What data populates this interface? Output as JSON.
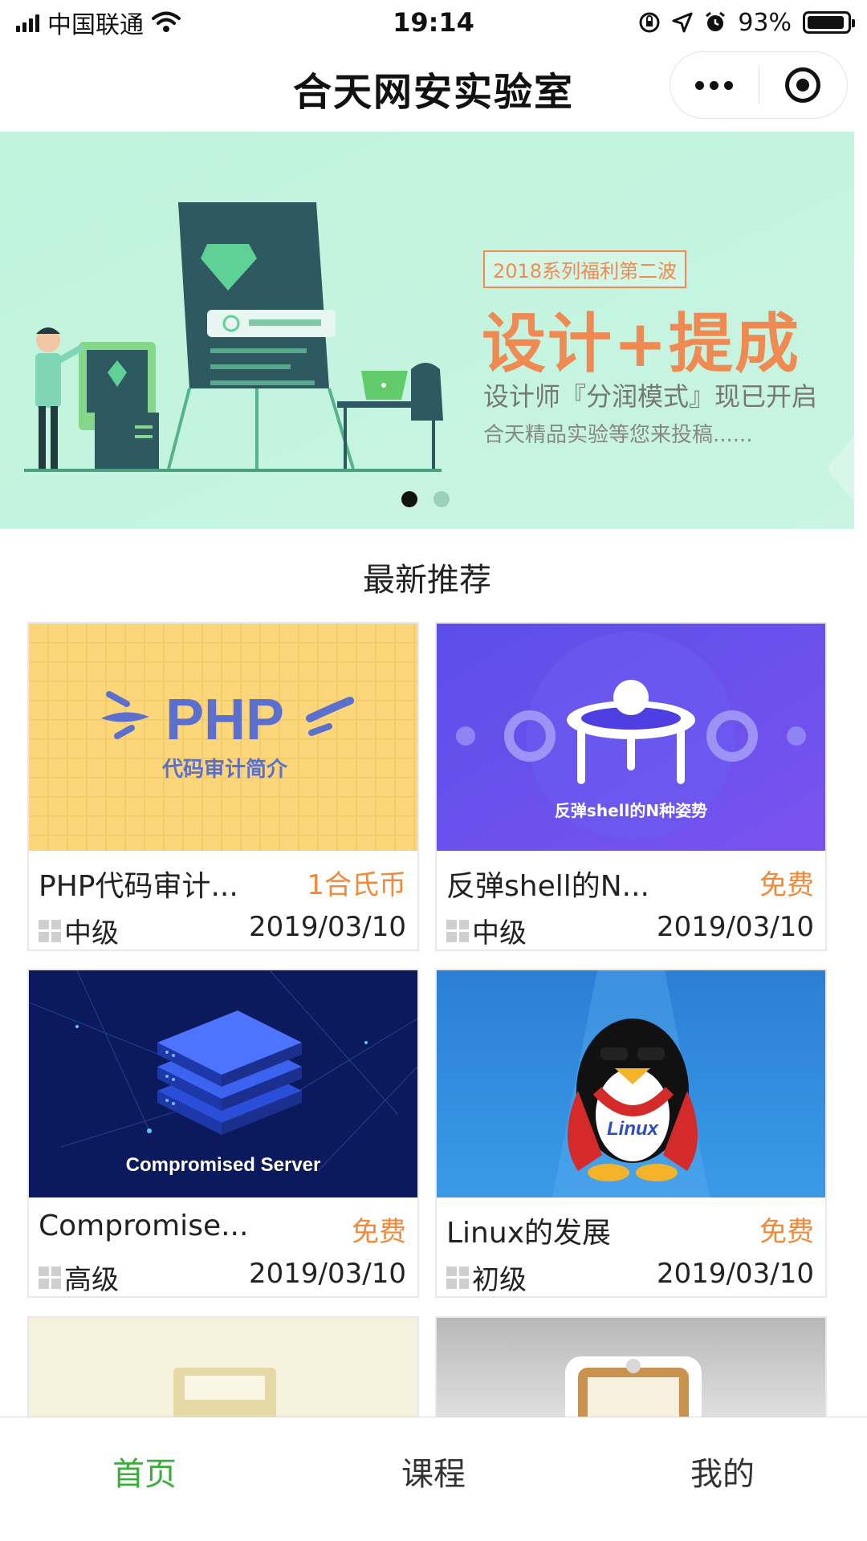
{
  "status_bar": {
    "carrier": "中国联通",
    "time": "19:14",
    "battery": "93%",
    "battery_level": 0.93,
    "icons": [
      "signal-icon",
      "wifi-icon",
      "rotation-lock-icon",
      "location-icon",
      "alarm-icon",
      "battery-icon"
    ]
  },
  "nav": {
    "title": "合天网安实验室",
    "more_icon": "more-dots-icon",
    "close_icon": "target-icon"
  },
  "banner": {
    "tag": "2018系列福利第二波",
    "headline": "设计+提成",
    "subtitle": "设计师『分润模式』现已开启",
    "subtitle2": "合天精品实验等您来投稿......",
    "page_count": 2,
    "active_page": 1
  },
  "section": {
    "title": "最新推荐"
  },
  "courses": [
    {
      "title": "PHP代码审计...",
      "price": "1合氏币",
      "level": "中级",
      "date": "2019/03/10",
      "thumb_text": "PHP",
      "thumb_sub": "代码审计简介"
    },
    {
      "title": "反弹shell的N...",
      "price": "免费",
      "level": "中级",
      "date": "2019/03/10",
      "thumb_text": "反弹shell的N种姿势"
    },
    {
      "title": "Compromise...",
      "price": "免费",
      "level": "高级",
      "date": "2019/03/10",
      "thumb_text": "Compromised Server"
    },
    {
      "title": "Linux的发展",
      "price": "免费",
      "level": "初级",
      "date": "2019/03/10",
      "thumb_text": "Linux"
    }
  ],
  "tabs": [
    {
      "label": "首页",
      "active": true
    },
    {
      "label": "课程",
      "active": false
    },
    {
      "label": "我的",
      "active": false
    }
  ],
  "colors": {
    "accent_green": "#3aad3a",
    "price_orange": "#f08a3a",
    "banner_bg": "#b8f0d8"
  }
}
